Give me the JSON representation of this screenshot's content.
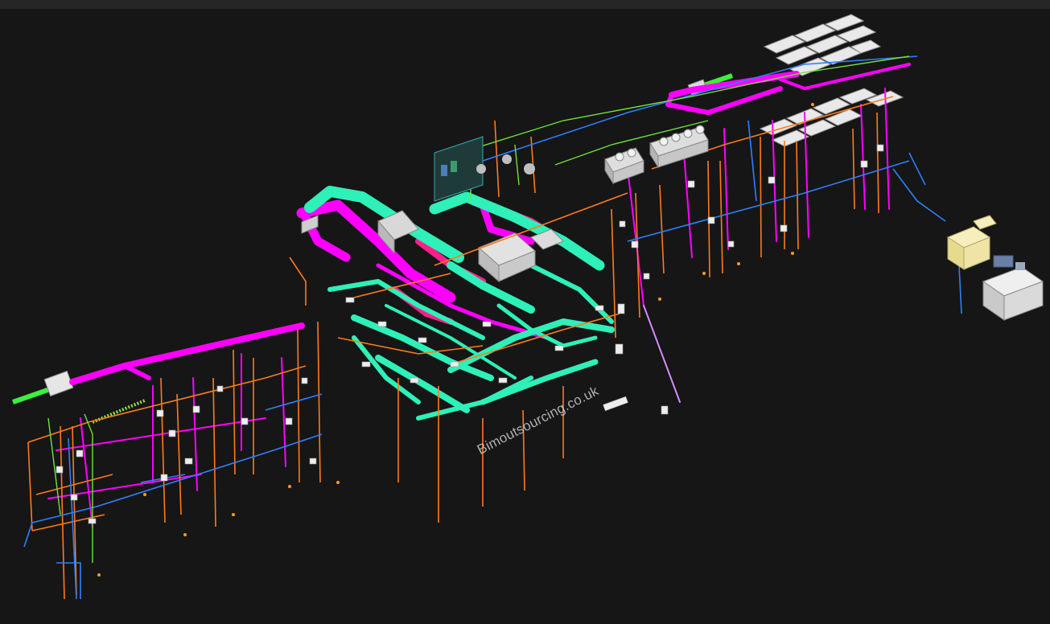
{
  "watermark": "Bimoutsourcing.co.uk",
  "colors": {
    "background": "#161616",
    "supply_duct": "#ff00ff",
    "return_duct": "#2ef0b8",
    "exhaust_duct": "#ff1f8a",
    "water_pipe": "#ff7a1a",
    "drain_pipe": "#2f7fff",
    "lighting": "#c8c8c8",
    "intake": "#3cf03c",
    "gas_pipe": "#8de03a",
    "plant": "#f3e9a6"
  },
  "icons": [
    "fresh-air-intake-left-icon",
    "fresh-air-intake-right-icon",
    "air-handling-unit-icon",
    "outdoor-unit-icon",
    "solar-panel-icon",
    "chiller-icon",
    "electrical-panel-icon"
  ]
}
